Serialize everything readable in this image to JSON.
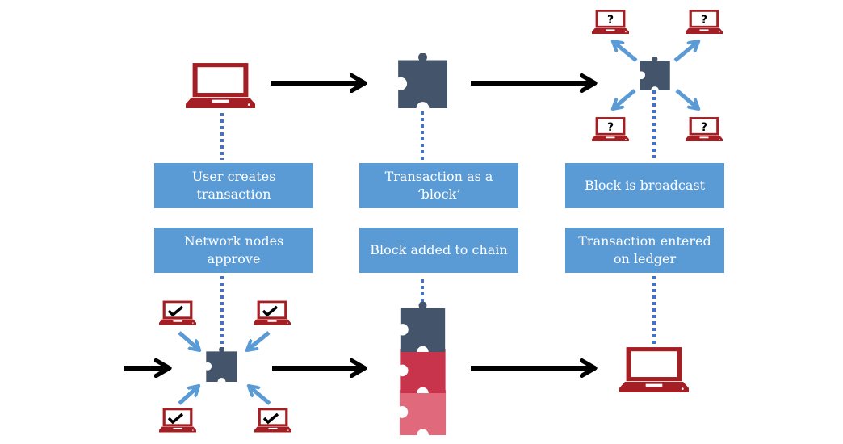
{
  "steps": [
    {
      "id": "create",
      "label": "User creates transaction"
    },
    {
      "id": "block",
      "label": "Transaction as a ‘block’"
    },
    {
      "id": "broadcast",
      "label": "Block is broadcast"
    },
    {
      "id": "approve",
      "label": "Network nodes approve"
    },
    {
      "id": "chain",
      "label": "Block added to chain"
    },
    {
      "id": "ledger",
      "label": "Transaction entered on ledger"
    }
  ],
  "colors": {
    "box": "#5b9bd5",
    "laptop": "#a31f24",
    "block_dark": "#44546a",
    "block_red": "#c9344d",
    "block_pink": "#e06a7b",
    "connector": "#4472c4",
    "small_arrow": "#5b9bd5",
    "flow_arrow": "#000000"
  },
  "icons": {
    "laptop": "laptop-icon",
    "block": "puzzle-piece-icon",
    "unknown_node": "question-mark",
    "approved_node": "check-mark"
  },
  "node_marks": {
    "unknown": "?"
  }
}
